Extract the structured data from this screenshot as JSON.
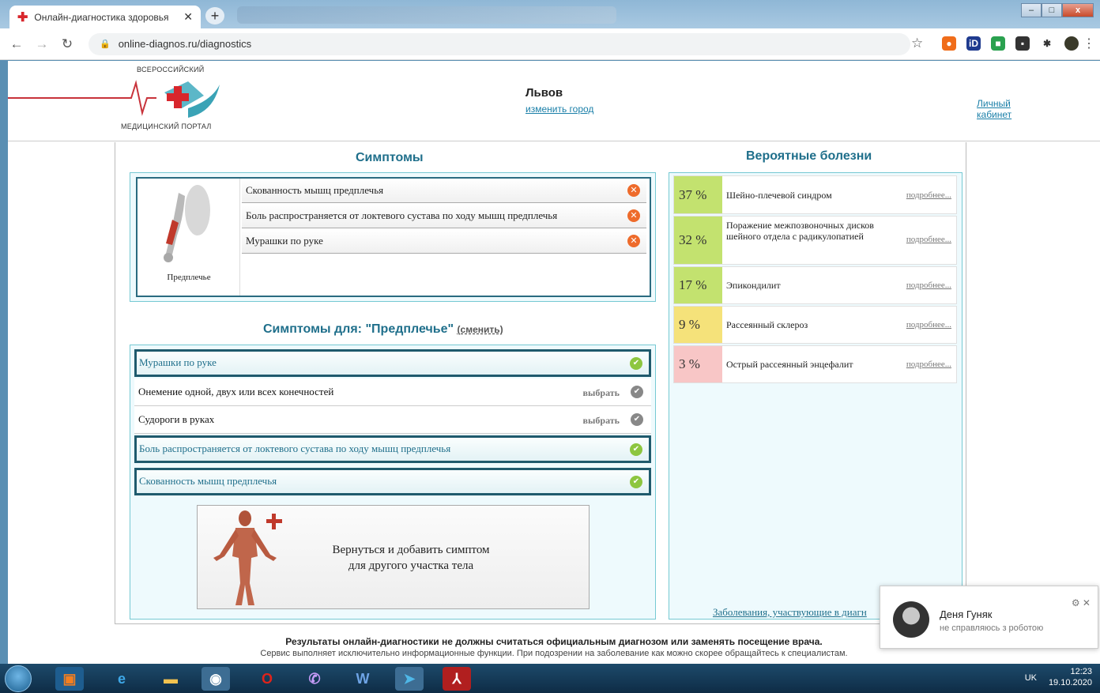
{
  "browser": {
    "tab_title": "Онлайн-диагностика здоровья",
    "tab_close": "✕",
    "url": "online-diagnos.ru/diagnostics",
    "window_controls": [
      "–",
      "□",
      "x"
    ]
  },
  "header": {
    "logo_line1": "ВСЕРОССИЙСКИЙ",
    "logo_line2": "МЕДИЦИНСКИЙ ПОРТАЛ",
    "city": "Львов",
    "change_city": "изменить город",
    "cabinet": "Личный кабинет"
  },
  "symptoms": {
    "title": "Симптомы",
    "body_part": "Предплечье",
    "items": [
      "Скованность мышц предплечья",
      "Боль распространяется от локтевого сустава по ходу мышц предплечья",
      "Мурашки по руке"
    ]
  },
  "symptoms_for": {
    "title": "Симптомы для: \"Предплечье\"",
    "change": "(сменить)",
    "pick_label": "выбрать",
    "items": [
      {
        "text": "Мурашки по руке",
        "selected": true
      },
      {
        "text": "Онемение одной, двух или всех конечностей",
        "selected": false
      },
      {
        "text": "Судороги в руках",
        "selected": false
      },
      {
        "text": "Боль распространяется от локтевого сустава по ходу мышц предплечья",
        "selected": true
      },
      {
        "text": "Скованность мышц предплечья",
        "selected": true
      }
    ],
    "back_line1": "Вернуться и добавить симптом",
    "back_line2": "для другого участка тела"
  },
  "diseases": {
    "title": "Вероятные болезни",
    "more_label": "подробнее...",
    "items": [
      {
        "pct": "37 %",
        "name": "Шейно-плечевой синдром",
        "color": "#c3e26f"
      },
      {
        "pct": "32 %",
        "name": "Поражение межпозвоночных дисков шейного отдела с радикулопатией",
        "color": "#c3e26f"
      },
      {
        "pct": "17 %",
        "name": "Эпикондилит",
        "color": "#c3e26f"
      },
      {
        "pct": "9 %",
        "name": "Рассеянный склероз",
        "color": "#f5e27a"
      },
      {
        "pct": "3 %",
        "name": "Острый рассеянный энцефалит",
        "color": "#f8c6c6"
      }
    ],
    "footer_link": "Заболевания, участвующие в диагн"
  },
  "footer": {
    "line1": "Результаты онлайн-диагностики не должны считаться официальным диагнозом или заменять посещение врача.",
    "line2": "Сервис выполняет исключительно информационные функции. При подозрении на заболевание как можно скорее обращайтесь к специалистам."
  },
  "notification": {
    "name": "Деня Гуняк",
    "message": "не справляюсь з роботою",
    "controls": "⚙ ✕"
  },
  "taskbar": {
    "tray": "UK",
    "time": "12:23",
    "date": "19.10.2020"
  }
}
